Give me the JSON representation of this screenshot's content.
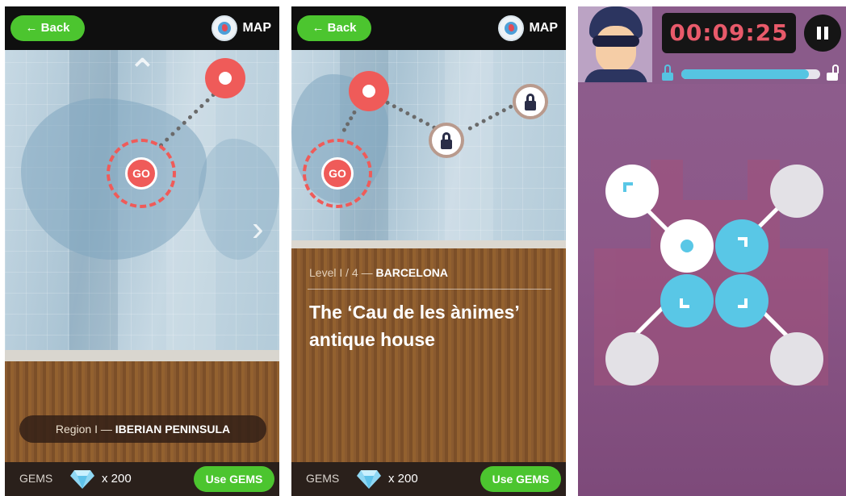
{
  "screens": [
    {
      "back_label": "← Back",
      "map_label": "MAP",
      "go_label": "GO",
      "region_prefix": "Region I — ",
      "region_name": "IBERIAN PENINSULA",
      "gems_label": "GEMS",
      "gems_count": "x 200",
      "use_gems_label": "Use GEMS"
    },
    {
      "back_label": "← Back",
      "map_label": "MAP",
      "go_label": "GO",
      "level_prefix": "Level I / 4 — ",
      "level_city": "BARCELONA",
      "level_title": "The ‘Cau de les ànimes’ antique house",
      "gems_label": "GEMS",
      "gems_count": "x 200",
      "use_gems_label": "Use GEMS"
    },
    {
      "timer": "00:09:25",
      "progress": 0.92
    }
  ],
  "colors": {
    "accent_green": "#4cc52f",
    "pin_red": "#ef5b59",
    "puzzle_blue": "#59c7e6",
    "timer_red": "#e85a6a"
  }
}
